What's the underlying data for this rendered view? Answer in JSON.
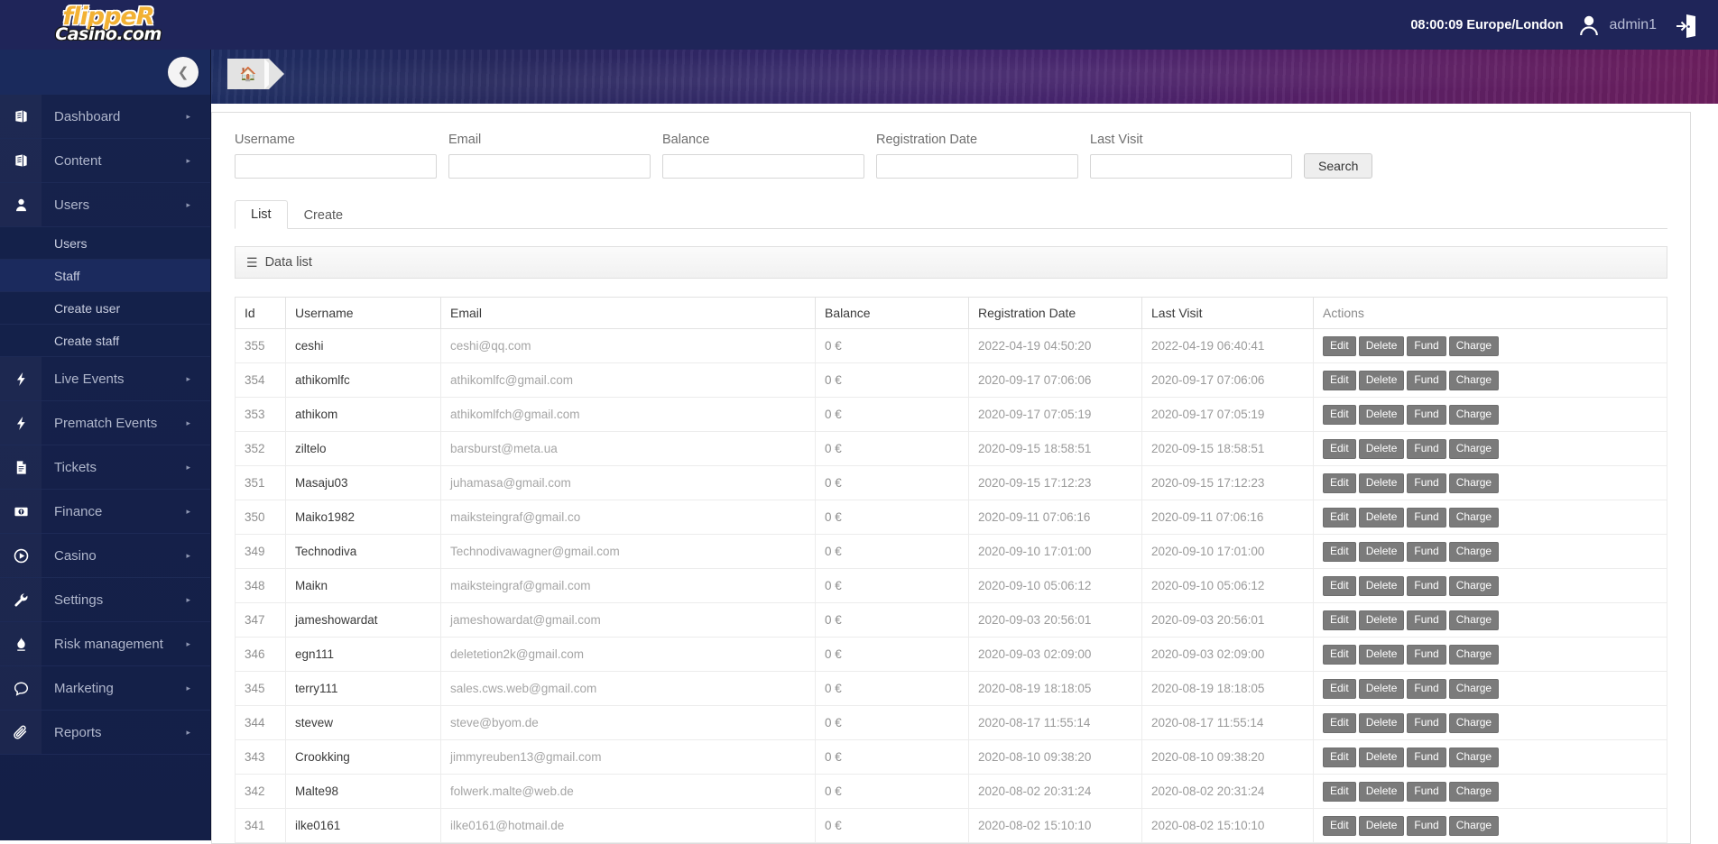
{
  "topbar": {
    "brand_line1": "flippeR",
    "brand_line2": "Casino.com",
    "clock": "08:00:09 Europe/London",
    "username": "admin1",
    "avatar_icon": "user-avatar-icon",
    "logout_icon": "logout-door-icon"
  },
  "sidebar": {
    "collapse_icon": "chevron-left-icon",
    "items": [
      {
        "label": "Dashboard",
        "icon": "book-icon",
        "caret": "▸",
        "type": "group"
      },
      {
        "label": "Content",
        "icon": "book-icon",
        "caret": "▸",
        "type": "group"
      },
      {
        "label": "Users",
        "icon": "user-icon",
        "caret": "▸",
        "type": "group"
      },
      {
        "label": "Users",
        "icon": "",
        "caret": "",
        "type": "sub"
      },
      {
        "label": "Staff",
        "icon": "",
        "caret": "",
        "type": "sub",
        "active": true
      },
      {
        "label": "Create user",
        "icon": "",
        "caret": "",
        "type": "sub"
      },
      {
        "label": "Create staff",
        "icon": "",
        "caret": "",
        "type": "sub"
      },
      {
        "label": "Live Events",
        "icon": "bolt-icon",
        "caret": "▸",
        "type": "group"
      },
      {
        "label": "Prematch Events",
        "icon": "bolt-icon",
        "caret": "▸",
        "type": "group"
      },
      {
        "label": "Tickets",
        "icon": "file-icon",
        "caret": "▸",
        "type": "group"
      },
      {
        "label": "Finance",
        "icon": "money-icon",
        "caret": "▸",
        "type": "group"
      },
      {
        "label": "Casino",
        "icon": "play-circle-icon",
        "caret": "▸",
        "type": "group"
      },
      {
        "label": "Settings",
        "icon": "wrench-icon",
        "caret": "▸",
        "type": "group"
      },
      {
        "label": "Risk management",
        "icon": "flame-icon",
        "caret": "▸",
        "type": "group"
      },
      {
        "label": "Marketing",
        "icon": "chat-icon",
        "caret": "▸",
        "type": "group"
      },
      {
        "label": "Reports",
        "icon": "paperclip-icon",
        "caret": "▸",
        "type": "group"
      }
    ]
  },
  "banner": {
    "home_icon": "home-icon"
  },
  "filters": {
    "username": {
      "label": "Username",
      "value": "",
      "placeholder": ""
    },
    "email": {
      "label": "Email",
      "value": "",
      "placeholder": ""
    },
    "balance": {
      "label": "Balance",
      "value": "",
      "placeholder": ""
    },
    "registration": {
      "label": "Registration Date",
      "value": "",
      "placeholder": ""
    },
    "lastvisit": {
      "label": "Last Visit",
      "value": "",
      "placeholder": ""
    },
    "search_label": "Search"
  },
  "tabs": [
    {
      "label": "List",
      "active": true
    },
    {
      "label": "Create",
      "active": false
    }
  ],
  "datalist": {
    "title": "Data list",
    "menu_icon": "hamburger-icon"
  },
  "table": {
    "columns": [
      "Id",
      "Username",
      "Email",
      "Balance",
      "Registration Date",
      "Last Visit",
      "Actions"
    ],
    "actions": [
      "Edit",
      "Delete",
      "Fund",
      "Charge"
    ],
    "rows": [
      {
        "id": "355",
        "username": "ceshi",
        "email": "ceshi@qq.com",
        "balance": "0 €",
        "registration": "2022-04-19 04:50:20",
        "last_visit": "2022-04-19 06:40:41"
      },
      {
        "id": "354",
        "username": "athikomlfc",
        "email": "athikomlfc@gmail.com",
        "balance": "0 €",
        "registration": "2020-09-17 07:06:06",
        "last_visit": "2020-09-17 07:06:06"
      },
      {
        "id": "353",
        "username": "athikom",
        "email": "athikomlfch@gmail.com",
        "balance": "0 €",
        "registration": "2020-09-17 07:05:19",
        "last_visit": "2020-09-17 07:05:19"
      },
      {
        "id": "352",
        "username": "ziltelo",
        "email": "barsburst@meta.ua",
        "balance": "0 €",
        "registration": "2020-09-15 18:58:51",
        "last_visit": "2020-09-15 18:58:51"
      },
      {
        "id": "351",
        "username": "Masaju03",
        "email": "juhamasa@gmail.com",
        "balance": "0 €",
        "registration": "2020-09-15 17:12:23",
        "last_visit": "2020-09-15 17:12:23"
      },
      {
        "id": "350",
        "username": "Maiko1982",
        "email": "maiksteingraf@gmail.co",
        "balance": "0 €",
        "registration": "2020-09-11 07:06:16",
        "last_visit": "2020-09-11 07:06:16"
      },
      {
        "id": "349",
        "username": "Technodiva",
        "email": "Technodivawagner@gmail.com",
        "balance": "0 €",
        "registration": "2020-09-10 17:01:00",
        "last_visit": "2020-09-10 17:01:00"
      },
      {
        "id": "348",
        "username": "Maikn",
        "email": "maiksteingraf@gmail.com",
        "balance": "0 €",
        "registration": "2020-09-10 05:06:12",
        "last_visit": "2020-09-10 05:06:12"
      },
      {
        "id": "347",
        "username": "jameshowardat",
        "email": "jameshowardat@gmail.com",
        "balance": "0 €",
        "registration": "2020-09-03 20:56:01",
        "last_visit": "2020-09-03 20:56:01"
      },
      {
        "id": "346",
        "username": "egn111",
        "email": "deletetion2k@gmail.com",
        "balance": "0 €",
        "registration": "2020-09-03 02:09:00",
        "last_visit": "2020-09-03 02:09:00"
      },
      {
        "id": "345",
        "username": "terry111",
        "email": "sales.cws.web@gmail.com",
        "balance": "0 €",
        "registration": "2020-08-19 18:18:05",
        "last_visit": "2020-08-19 18:18:05"
      },
      {
        "id": "344",
        "username": "stevew",
        "email": "steve@byom.de",
        "balance": "0 €",
        "registration": "2020-08-17 11:55:14",
        "last_visit": "2020-08-17 11:55:14"
      },
      {
        "id": "343",
        "username": "Crookking",
        "email": "jimmyreuben13@gmail.com",
        "balance": "0 €",
        "registration": "2020-08-10 09:38:20",
        "last_visit": "2020-08-10 09:38:20"
      },
      {
        "id": "342",
        "username": "Malte98",
        "email": "folwerk.malte@web.de",
        "balance": "0 €",
        "registration": "2020-08-02 20:31:24",
        "last_visit": "2020-08-02 20:31:24"
      },
      {
        "id": "341",
        "username": "ilke0161",
        "email": "ilke0161@hotmail.de",
        "balance": "0 €",
        "registration": "2020-08-02 15:10:10",
        "last_visit": "2020-08-02 15:10:10"
      }
    ]
  },
  "colors": {
    "topbar_bg": "#1f2559",
    "sidebar_bg": "#152149",
    "brand_yellow": "#f2b134",
    "banner_start": "#1e2e63",
    "banner_end": "#6d1f5e",
    "action_button": "#7b7b7b"
  }
}
